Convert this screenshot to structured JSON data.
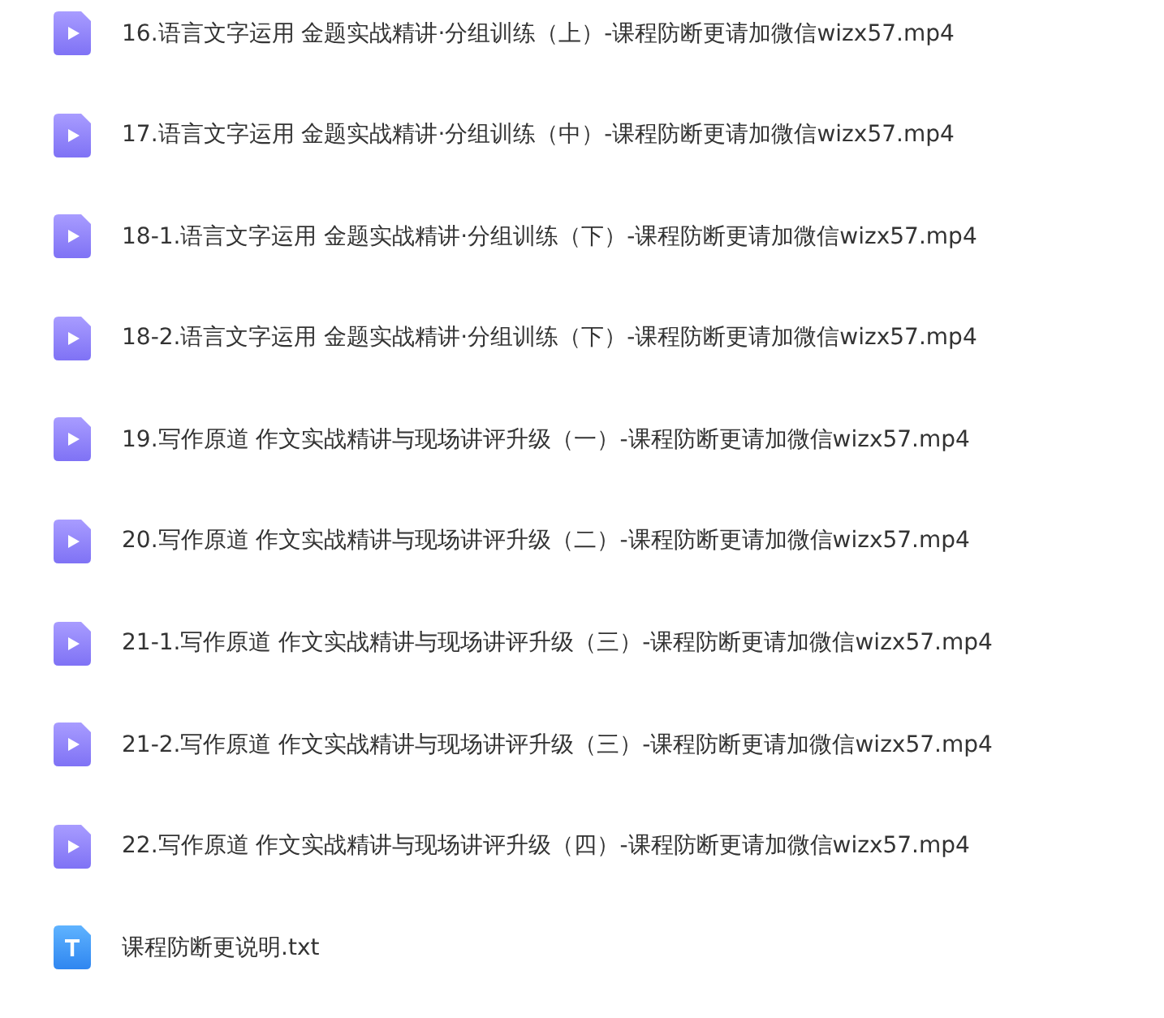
{
  "files": [
    {
      "kind": "video",
      "name": "16.语言文字运用 金题实战精讲·分组训练（上）-课程防断更请加微信wizx57.mp4"
    },
    {
      "kind": "video",
      "name": "17.语言文字运用 金题实战精讲·分组训练（中）-课程防断更请加微信wizx57.mp4"
    },
    {
      "kind": "video",
      "name": "18-1.语言文字运用 金题实战精讲·分组训练（下）-课程防断更请加微信wizx57.mp4"
    },
    {
      "kind": "video",
      "name": "18-2.语言文字运用 金题实战精讲·分组训练（下）-课程防断更请加微信wizx57.mp4"
    },
    {
      "kind": "video",
      "name": "19.写作原道 作文实战精讲与现场讲评升级（一）-课程防断更请加微信wizx57.mp4"
    },
    {
      "kind": "video",
      "name": "20.写作原道 作文实战精讲与现场讲评升级（二）-课程防断更请加微信wizx57.mp4"
    },
    {
      "kind": "video",
      "name": "21-1.写作原道 作文实战精讲与现场讲评升级（三）-课程防断更请加微信wizx57.mp4"
    },
    {
      "kind": "video",
      "name": "21-2.写作原道 作文实战精讲与现场讲评升级（三）-课程防断更请加微信wizx57.mp4"
    },
    {
      "kind": "video",
      "name": "22.写作原道 作文实战精讲与现场讲评升级（四）-课程防断更请加微信wizx57.mp4"
    },
    {
      "kind": "text",
      "name": "课程防断更说明.txt"
    }
  ]
}
